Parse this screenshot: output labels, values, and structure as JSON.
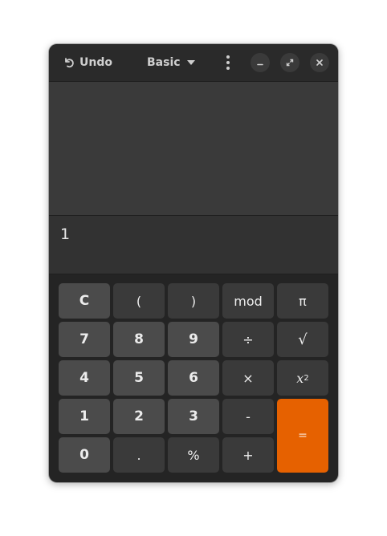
{
  "header": {
    "undo_label": "Undo",
    "mode_label": "Basic",
    "menu_icon": "vertical-dots-icon",
    "minimize_icon": "minimize-icon",
    "maximize_icon": "maximize-icon",
    "close_icon": "close-icon"
  },
  "display": {
    "history": "",
    "input": "1"
  },
  "keypad": {
    "rows": [
      [
        "C",
        "(",
        ")",
        "mod",
        "π"
      ],
      [
        "7",
        "8",
        "9",
        "÷",
        "√"
      ],
      [
        "4",
        "5",
        "6",
        "×",
        "x²"
      ],
      [
        "1",
        "2",
        "3",
        "-",
        "="
      ],
      [
        "0",
        ".",
        "%",
        "+"
      ]
    ],
    "clear": "C",
    "open_paren": "(",
    "close_paren": ")",
    "mod": "mod",
    "pi": "π",
    "seven": "7",
    "eight": "8",
    "nine": "9",
    "divide": "÷",
    "sqrt": "√",
    "four": "4",
    "five": "5",
    "six": "6",
    "multiply": "×",
    "square_base": "x",
    "square_exp": "2",
    "one": "1",
    "two": "2",
    "three": "3",
    "subtract": "-",
    "equals": "=",
    "zero": "0",
    "decimal": ".",
    "percent": "%",
    "add": "+"
  },
  "colors": {
    "window_bg": "#242424",
    "header_bg": "#2a2a2a",
    "number_key": "#4b4b4b",
    "operator_key": "#3a3a3a",
    "equals_key": "#e66100"
  }
}
